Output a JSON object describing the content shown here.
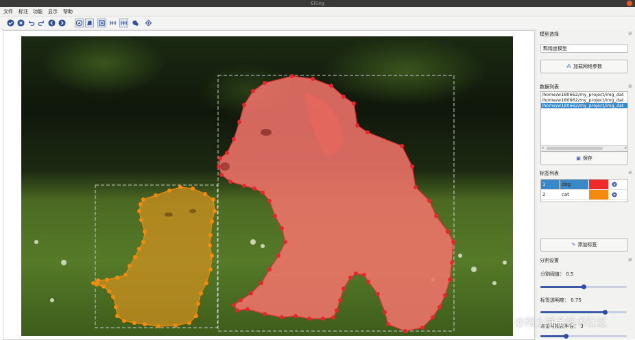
{
  "window": {
    "title": "EISeg"
  },
  "menu": {
    "items": [
      "文件",
      "标注",
      "功能",
      "显示",
      "帮助"
    ]
  },
  "toolbar": {
    "tools": [
      {
        "name": "finish-annotation-icon",
        "glyph": "check",
        "boxed": false
      },
      {
        "name": "clear-icon",
        "glyph": "x",
        "boxed": false
      },
      {
        "name": "undo-icon",
        "glyph": "undo",
        "boxed": false
      },
      {
        "name": "redo-icon",
        "glyph": "redo",
        "boxed": false
      },
      {
        "name": "prev-image-icon",
        "glyph": "left",
        "boxed": false
      },
      {
        "name": "next-image-icon",
        "glyph": "right",
        "boxed": false
      },
      {
        "name": "mask-toggle-icon",
        "glyph": "mask1",
        "boxed": true
      },
      {
        "name": "polygon-toggle-icon",
        "glyph": "mask2",
        "boxed": true
      },
      {
        "name": "bbox-toggle-icon",
        "glyph": "box",
        "boxed": true
      },
      {
        "name": "grid-icon",
        "glyph": "grid",
        "boxed": false
      },
      {
        "name": "large-image-icon",
        "glyph": "grid2",
        "boxed": true
      },
      {
        "name": "medical-icon",
        "glyph": "blob",
        "boxed": false
      },
      {
        "name": "remote-sensing-icon",
        "glyph": "diamond",
        "boxed": false
      }
    ]
  },
  "panel": {
    "model": {
      "title": "模型选择",
      "selected": "高精度模型",
      "load_button": "加载网络参数"
    },
    "data_list": {
      "title": "数据列表",
      "files": [
        "/home/w180662/my_project/img_dat",
        "/home/w180662/my_project/img_dat",
        "/home/w180662/my_project/img_dat"
      ],
      "selected_index": 2,
      "save_button": "保存"
    },
    "labels": {
      "title": "标签列表",
      "items": [
        {
          "index": "1",
          "name": "dog",
          "color": "#ee2a2a",
          "selected": true
        },
        {
          "index": "2",
          "name": "cat",
          "color": "#f58a0c",
          "selected": false
        }
      ],
      "add_button": "添加标签"
    },
    "segmentation": {
      "title": "分割设置",
      "threshold_label": "分割阈值：",
      "threshold_value": "0.5",
      "threshold_fraction": 0.5,
      "opacity_label": "标签透明度：",
      "opacity_value": "0.75",
      "opacity_fraction": 0.75,
      "third_label": "点击可视化半径：",
      "third_value": "3",
      "third_fraction": 0.3
    }
  },
  "watermark": "@稀土掘金技术社区",
  "colors": {
    "dog": "#ee2a2a",
    "cat": "#f58a0c",
    "accent": "#2d4fa5"
  }
}
